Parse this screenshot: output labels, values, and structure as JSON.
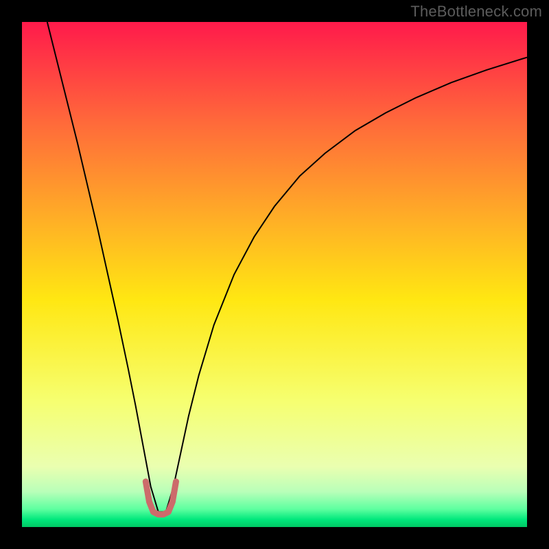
{
  "watermark": "TheBottleneck.com",
  "chart_data": {
    "type": "line",
    "title": "",
    "xlabel": "",
    "ylabel": "",
    "xlim": [
      0,
      100
    ],
    "ylim": [
      0,
      100
    ],
    "grid": false,
    "legend": false,
    "background_gradient": {
      "stops": [
        {
          "offset": 0.0,
          "color": "#ff1a4b"
        },
        {
          "offset": 0.2,
          "color": "#ff6a3a"
        },
        {
          "offset": 0.4,
          "color": "#ffb225"
        },
        {
          "offset": 0.55,
          "color": "#ffe712"
        },
        {
          "offset": 0.75,
          "color": "#f6ff70"
        },
        {
          "offset": 0.88,
          "color": "#eaffb0"
        },
        {
          "offset": 0.93,
          "color": "#b9ffb9"
        },
        {
          "offset": 0.965,
          "color": "#5cff9f"
        },
        {
          "offset": 0.985,
          "color": "#00e87c"
        },
        {
          "offset": 1.0,
          "color": "#00c965"
        }
      ]
    },
    "series": [
      {
        "name": "bottleneck-curve",
        "stroke": "#000000",
        "stroke_width": 2.0,
        "x": [
          5.0,
          7.0,
          9.0,
          11.0,
          13.0,
          15.0,
          17.0,
          19.0,
          21.0,
          22.5,
          24.0,
          25.5,
          27.0,
          28.5,
          30.0,
          31.5,
          33.0,
          35.0,
          38.0,
          42.0,
          46.0,
          50.0,
          55.0,
          60.0,
          66.0,
          72.0,
          78.0,
          85.0,
          92.0,
          100.0
        ],
        "values": [
          100.0,
          92.0,
          84.0,
          76.0,
          67.5,
          59.0,
          50.0,
          41.0,
          31.5,
          24.0,
          16.0,
          8.0,
          3.0,
          3.0,
          8.0,
          15.0,
          22.0,
          30.0,
          40.0,
          50.0,
          57.5,
          63.5,
          69.5,
          74.0,
          78.5,
          82.0,
          85.0,
          88.0,
          90.5,
          93.0
        ]
      },
      {
        "name": "optimal-zone-marker",
        "stroke": "#cc6b6b",
        "stroke_width": 9.0,
        "linecap": "round",
        "x": [
          24.5,
          25.2,
          26.0,
          27.0,
          28.0,
          29.0,
          29.8,
          30.5
        ],
        "values": [
          9.0,
          5.0,
          3.0,
          2.5,
          2.5,
          3.0,
          5.0,
          9.0
        ]
      }
    ]
  }
}
